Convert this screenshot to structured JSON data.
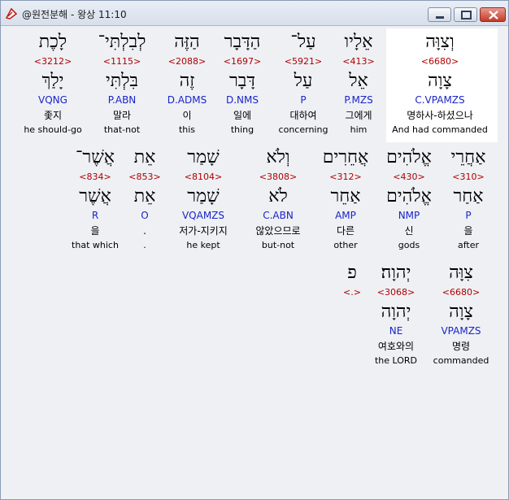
{
  "window": {
    "title": "@원전분해 - 왕상 11:10"
  },
  "rows": [
    [
      {
        "top": "לָכֶת",
        "strong": "<3212>",
        "lemma": "יָלַךְ",
        "parse": "VQNG",
        "kor": "좇지",
        "eng": "he should-go"
      },
      {
        "top": "לְבִלְתִּי־",
        "strong": "<1115>",
        "lemma": "בִּלְתִּי",
        "parse": "P.ABN",
        "kor": "말라",
        "eng": "that-not"
      },
      {
        "top": "הַזֶּה",
        "strong": "<2088>",
        "lemma": "זֶה",
        "parse": "D.ADMS",
        "kor": "이",
        "eng": "this"
      },
      {
        "top": "הַדָּבָר",
        "strong": "<1697>",
        "lemma": "דָּבָר",
        "parse": "D.NMS",
        "kor": "일에",
        "eng": "thing"
      },
      {
        "top": "עַל־",
        "strong": "<5921>",
        "lemma": "עַל",
        "parse": "P",
        "kor": "대하여",
        "eng": "concerning"
      },
      {
        "top": "אֵלָיו",
        "strong": "<413>",
        "lemma": "אֵל",
        "parse": "P.MZS",
        "kor": "그에게",
        "eng": "him"
      },
      {
        "top": "וְצִוָּה",
        "strong": "<6680>",
        "lemma": "צָוָה",
        "parse": "C.VPAMZS",
        "kor": "명하사-하셨으나",
        "eng": "And had commanded"
      }
    ],
    [
      {
        "top": "אֲשֶׁר־",
        "strong": "<834>",
        "lemma": "אֲשֶׁר",
        "parse": "R",
        "kor": "을",
        "eng": "that which"
      },
      {
        "top": "אֵת",
        "strong": "<853>",
        "lemma": "אֵת",
        "parse": "O",
        "kor": ".",
        "eng": "."
      },
      {
        "top": "שָׁמַר",
        "strong": "<8104>",
        "lemma": "שָׁמַר",
        "parse": "VQAMZS",
        "kor": "저가-지키지",
        "eng": "he kept"
      },
      {
        "top": "וְלֹא",
        "strong": "<3808>",
        "lemma": "לֹא",
        "parse": "C.ABN",
        "kor": "않았으므로",
        "eng": "but-not"
      },
      {
        "top": "אֲחֵרִים",
        "strong": "<312>",
        "lemma": "אַחֵר",
        "parse": "AMP",
        "kor": "다른",
        "eng": "other"
      },
      {
        "top": "אֱלֹהִים",
        "strong": "<430>",
        "lemma": "אֱלֹהִים",
        "parse": "NMP",
        "kor": "신",
        "eng": "gods"
      },
      {
        "top": "אַחֲרֵי",
        "strong": "<310>",
        "lemma": "אַחַר",
        "parse": "P",
        "kor": "을",
        "eng": "after"
      }
    ],
    [
      {
        "top": "פ",
        "strong": "<.>",
        "lemma": "",
        "parse": "",
        "kor": "",
        "eng": ""
      },
      {
        "top": "יְהוָה׃",
        "strong": "<3068>",
        "lemma": "יְהוָה",
        "parse": "NE",
        "kor": "여호와의",
        "eng": "the LORD"
      },
      {
        "top": "צִוָּה",
        "strong": "<6680>",
        "lemma": "צָוָה",
        "parse": "VPAMZS",
        "kor": "명령",
        "eng": "commanded"
      }
    ]
  ]
}
